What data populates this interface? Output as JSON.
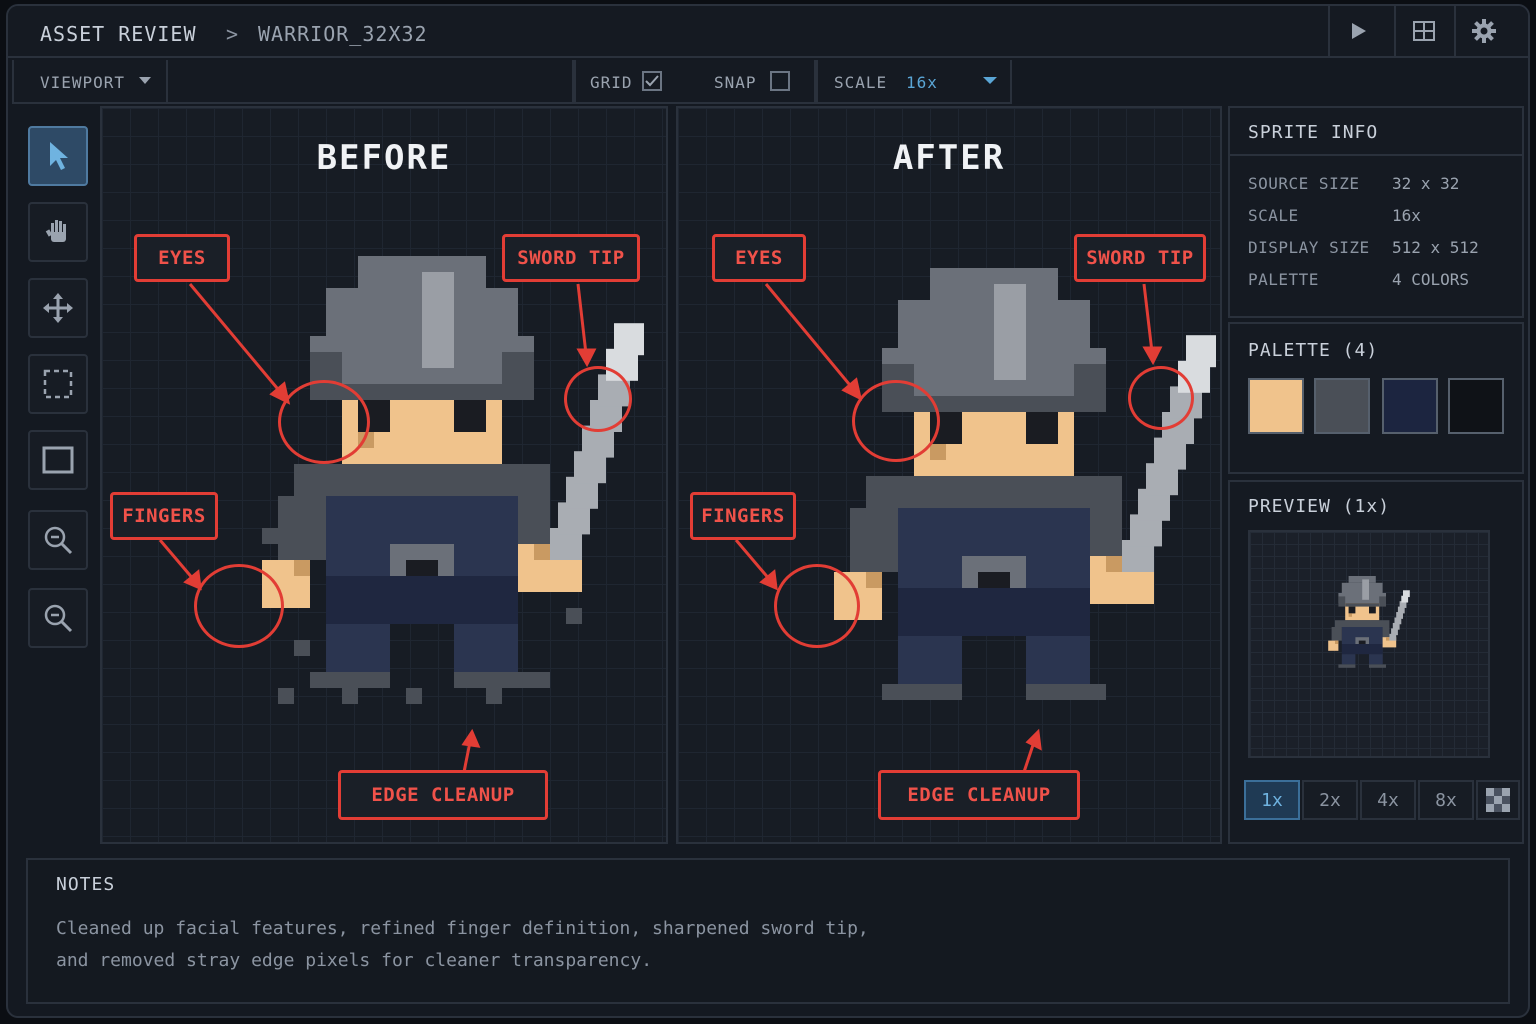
{
  "breadcrumb": {
    "root": "ASSET REVIEW",
    "separator": ">",
    "current": "WARRIOR_32X32"
  },
  "title_icons": [
    "play-icon",
    "grid-layout-icon",
    "gear-icon"
  ],
  "toolbar": {
    "viewport_label": "VIEWPORT",
    "grid_label": "GRID",
    "grid_checked": true,
    "snap_label": "SNAP",
    "snap_checked": false,
    "scale_label": "SCALE",
    "scale_value": "16x"
  },
  "tools": [
    "pointer-icon",
    "hand-icon",
    "move-icon",
    "marquee-select-icon",
    "rectangle-icon",
    "zoom-in-icon",
    "zoom-out-icon"
  ],
  "panels": {
    "before": {
      "title": "BEFORE",
      "callouts": {
        "eyes": "EYES",
        "sword_tip": "SWORD TIP",
        "fingers": "FINGERS",
        "edge_cleanup": "EDGE CLEANUP"
      }
    },
    "after": {
      "title": "AFTER",
      "callouts": {
        "eyes": "EYES",
        "sword_tip": "SWORD TIP",
        "fingers": "FINGERS",
        "edge_cleanup": "EDGE CLEANUP"
      }
    }
  },
  "sprite_info": {
    "title": "SPRITE INFO",
    "rows": [
      {
        "label": "SOURCE SIZE",
        "value": "32 x 32"
      },
      {
        "label": "SCALE",
        "value": "16x"
      },
      {
        "label": "DISPLAY SIZE",
        "value": "512 x 512"
      },
      {
        "label": "PALETTE",
        "value": "4 COLORS"
      }
    ]
  },
  "palette": {
    "title": "PALETTE (4)",
    "colors": [
      "#f0c38c",
      "#4a4f57",
      "#1c2540",
      "#0f1217"
    ]
  },
  "preview": {
    "title": "PREVIEW (1x)",
    "zoom_options": [
      "1x",
      "2x",
      "4x",
      "8x"
    ],
    "active_zoom": "1x",
    "extra_icon": "checkerboard-icon"
  },
  "notes": {
    "title": "NOTES",
    "line1": "Cleaned up facial features, refined finger definition, sharpened sword tip,",
    "line2": "and removed stray edge pixels for cleaner transparency."
  }
}
